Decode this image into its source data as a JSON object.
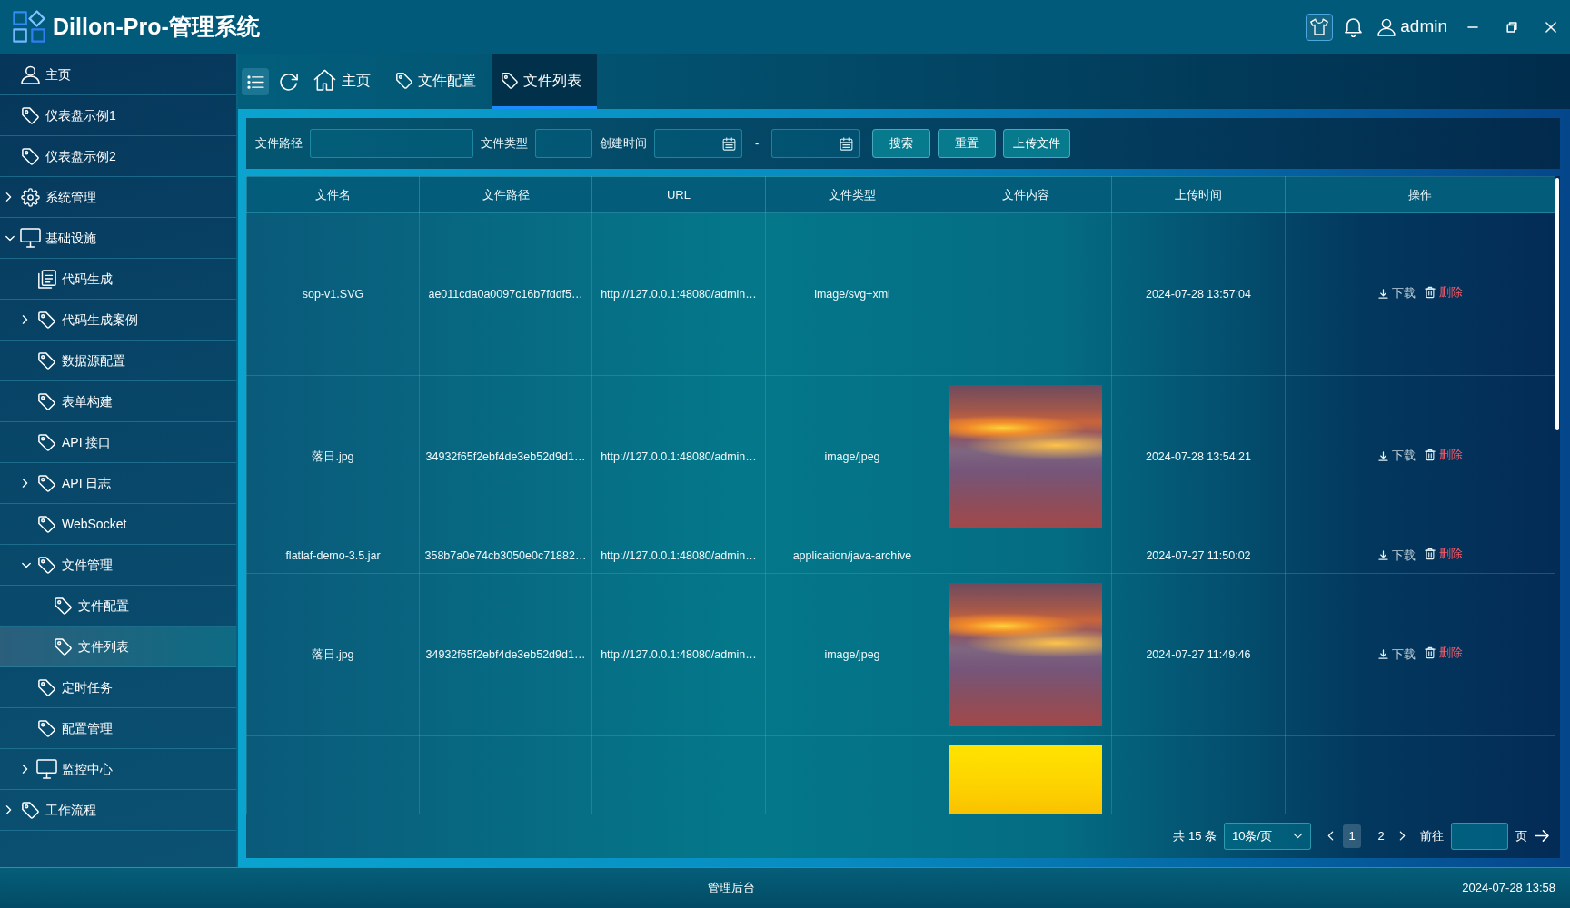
{
  "window": {
    "title": "Dillon-Pro-管理系统"
  },
  "header": {
    "user": "admin"
  },
  "sidebar": {
    "items": [
      {
        "label": "主页",
        "kind": "profile",
        "selected": false
      },
      {
        "label": "仪表盘示例1",
        "kind": "page",
        "selected": false
      },
      {
        "label": "仪表盘示例2",
        "kind": "page",
        "selected": false
      },
      {
        "label": "系统管理",
        "kind": "settings",
        "selected": false,
        "expanded": false
      },
      {
        "label": "基础设施",
        "kind": "module",
        "selected": false,
        "expanded": true,
        "children": [
          {
            "label": "代码生成",
            "kind": "document",
            "selected": false
          },
          {
            "label": "代码生成案例",
            "kind": "page",
            "selected": false,
            "expanded": false
          },
          {
            "label": "数据源配置",
            "kind": "page",
            "selected": false
          },
          {
            "label": "表单构建",
            "kind": "page",
            "selected": false
          },
          {
            "label": "API 接口",
            "kind": "page",
            "selected": false
          },
          {
            "label": "API 日志",
            "kind": "page",
            "selected": false,
            "expanded": false
          },
          {
            "label": "WebSocket",
            "kind": "page",
            "selected": false
          },
          {
            "label": "文件管理",
            "kind": "page",
            "selected": false,
            "expanded": true,
            "children": [
              {
                "label": "文件配置",
                "kind": "page",
                "selected": false
              },
              {
                "label": "文件列表",
                "kind": "page",
                "selected": true
              }
            ]
          },
          {
            "label": "定时任务",
            "kind": "page",
            "selected": false
          },
          {
            "label": "配置管理",
            "kind": "page",
            "selected": false
          },
          {
            "label": "监控中心",
            "kind": "module",
            "selected": false,
            "expanded": false
          }
        ]
      },
      {
        "label": "工作流程",
        "kind": "page",
        "selected": false,
        "expanded": false
      }
    ]
  },
  "tabs": [
    {
      "label": "主页",
      "kind": "home",
      "selected": false
    },
    {
      "label": "文件配置",
      "kind": "page",
      "selected": false
    },
    {
      "label": "文件列表",
      "kind": "page",
      "selected": true
    }
  ],
  "filters": {
    "fields": [
      {
        "label": "文件路径",
        "kind": "text"
      },
      {
        "label": "文件类型",
        "kind": "text"
      },
      {
        "label": "创建时间",
        "kind": "daterange",
        "separator": "-"
      }
    ],
    "buttons": [
      "搜索",
      "重置",
      "上传文件"
    ]
  },
  "table": {
    "columns": [
      "文件名",
      "文件路径",
      "URL",
      "文件类型",
      "文件内容",
      "上传时间",
      "操作"
    ],
    "rows": [
      {
        "name": "sop-v1.SVG",
        "path": "ae011cda0a0097c16b7fddf5…",
        "url": "http://127.0.0.1:48080/admin…",
        "type": "image/svg+xml",
        "preview": {
          "kind": "blank"
        },
        "time": "2024-07-28 13:57:04",
        "actions": [
          {
            "label": "下载",
            "kind": "download"
          },
          {
            "label": "删除",
            "kind": "delete"
          }
        ]
      },
      {
        "name": "落日.jpg",
        "path": "34932f65f2ebf4de3eb52d9d1…",
        "url": "http://127.0.0.1:48080/admin…",
        "type": "image/jpeg",
        "preview": {
          "kind": "sunset"
        },
        "time": "2024-07-28 13:54:21",
        "actions": [
          {
            "label": "下载",
            "kind": "download"
          },
          {
            "label": "删除",
            "kind": "delete"
          }
        ]
      },
      {
        "name": "flatlaf-demo-3.5.jar",
        "path": "358b7a0e74cb3050e0c71882…",
        "url": "http://127.0.0.1:48080/admin…",
        "type": "application/java-archive",
        "time": "2024-07-27 11:50:02",
        "actions": [
          {
            "label": "下载",
            "kind": "download"
          },
          {
            "label": "删除",
            "kind": "delete"
          }
        ]
      },
      {
        "name": "落日.jpg",
        "path": "34932f65f2ebf4de3eb52d9d1…",
        "url": "http://127.0.0.1:48080/admin…",
        "type": "image/jpeg",
        "preview": {
          "kind": "sunset"
        },
        "time": "2024-07-27 11:49:46",
        "actions": [
          {
            "label": "下载",
            "kind": "download"
          },
          {
            "label": "删除",
            "kind": "delete"
          }
        ]
      },
      {
        "preview": {
          "kind": "gold"
        }
      }
    ]
  },
  "pagination": {
    "total": "共 15 条",
    "page_size": "10条/页",
    "pages": [
      {
        "label": "1",
        "selected": true
      },
      {
        "label": "2",
        "selected": false
      }
    ],
    "goto_label": "前往",
    "goto_suffix": "页"
  },
  "status_bar": {
    "center": "管理后台",
    "time": "2024-07-28 13:58"
  }
}
